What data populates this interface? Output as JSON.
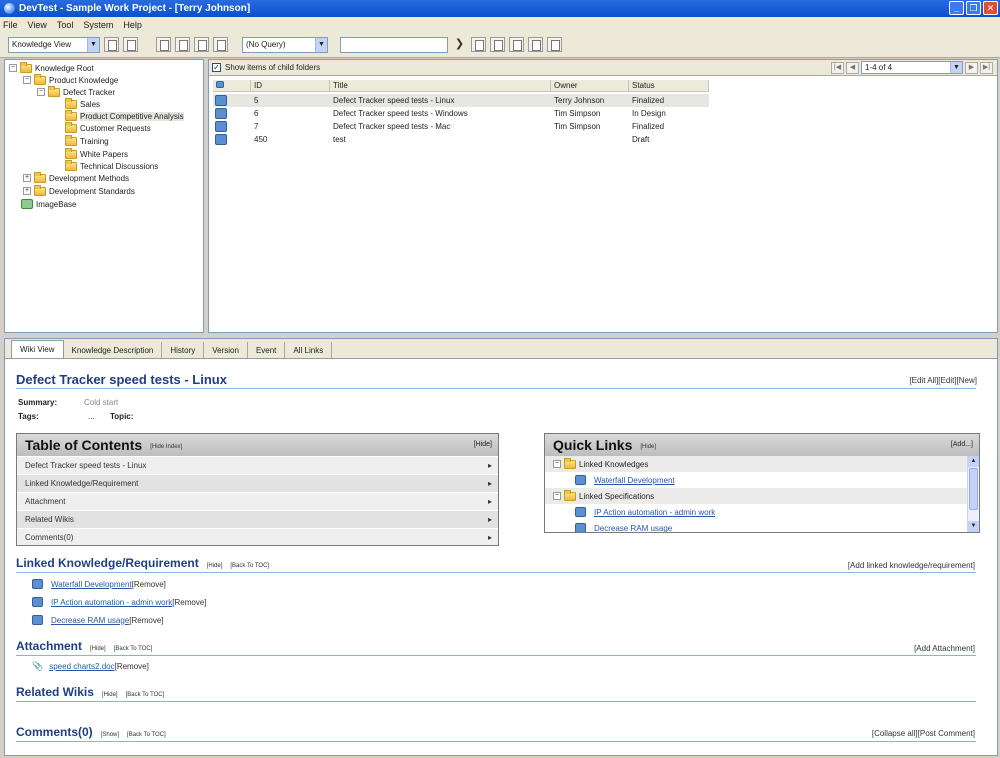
{
  "window": {
    "title": "DevTest - Sample Work Project - [Terry Johnson]"
  },
  "menu": [
    "File",
    "View",
    "Tool",
    "System",
    "Help"
  ],
  "toolbar": {
    "view_select": "Knowledge View",
    "query_select": "(No Query)",
    "search_value": ""
  },
  "tree": {
    "items": [
      {
        "label": "Knowledge Root",
        "level": 0,
        "expander": "-"
      },
      {
        "label": "Product Knowledge",
        "level": 1,
        "expander": "-"
      },
      {
        "label": "Defect Tracker",
        "level": 2,
        "expander": "-"
      },
      {
        "label": "Sales",
        "level": 3,
        "expander": ""
      },
      {
        "label": "Product Competitive Analysis",
        "level": 3,
        "expander": "",
        "selected": true
      },
      {
        "label": "Customer Requests",
        "level": 3,
        "expander": ""
      },
      {
        "label": "Training",
        "level": 3,
        "expander": ""
      },
      {
        "label": "White Papers",
        "level": 3,
        "expander": ""
      },
      {
        "label": "Technical Discussions",
        "level": 3,
        "expander": ""
      },
      {
        "label": "Development Methods",
        "level": 1,
        "expander": "+"
      },
      {
        "label": "Development Standards",
        "level": 1,
        "expander": "+"
      },
      {
        "label": "ImageBase",
        "level": 0,
        "expander": "",
        "image": true
      }
    ]
  },
  "list": {
    "show_child_label": "Show items of child folders",
    "pager": "1-4 of 4",
    "columns": [
      "ID",
      "Title",
      "Owner",
      "Status"
    ],
    "rows": [
      {
        "id": "5",
        "title": "Defect Tracker speed tests - Linux",
        "owner": "Terry Johnson",
        "status": "Finalized"
      },
      {
        "id": "6",
        "title": "Defect Tracker speed tests - Windows",
        "owner": "Tim Simpson",
        "status": "In Design"
      },
      {
        "id": "7",
        "title": "Defect Tracker speed tests - Mac",
        "owner": "Tim Simpson",
        "status": "Finalized"
      },
      {
        "id": "450",
        "title": "test",
        "owner": "",
        "status": "Draft"
      }
    ]
  },
  "tabs": [
    "Wiki View",
    "Knowledge Description",
    "History",
    "Version",
    "Event",
    "All Links"
  ],
  "wiki": {
    "title": "Defect Tracker speed tests - Linux",
    "top_links": "[Edit All][Edit][New]",
    "summary_label": "Summary:",
    "summary_value": "Cold start",
    "tags_label": "Tags:",
    "tags_value": "...",
    "topic_label": "Topic:",
    "toc": {
      "title": "Table of Contents",
      "hide_index": "[Hide Index]",
      "hide": "[Hide]",
      "items": [
        "Defect Tracker speed tests - Linux",
        "Linked Knowledge/Requirement",
        "Attachment",
        "Related Wikis",
        "Comments(0)"
      ]
    },
    "quick_links": {
      "title": "Quick Links",
      "hide": "[Hide]",
      "add": "[Add...]",
      "group1": "Linked Knowledges",
      "group1_items": [
        "Waterfall Development"
      ],
      "group2": "Linked Specifications",
      "group2_items": [
        "IP Action automation - admin work",
        "Decrease RAM usage"
      ]
    },
    "linked": {
      "title": "Linked Knowledge/Requirement",
      "hide": "[Hide]",
      "back": "[Back To TOC]",
      "add": "[Add linked knowledge/requirement]",
      "items": [
        {
          "label": "Waterfall Development",
          "remove": "[Remove]"
        },
        {
          "label": "IP Action automation - admin work",
          "remove": "[Remove]"
        },
        {
          "label": "Decrease RAM usage",
          "remove": "[Remove]"
        }
      ]
    },
    "attachment": {
      "title": "Attachment",
      "hide": "[Hide]",
      "back": "[Back To TOC]",
      "add": "[Add Attachment]",
      "file": "speed charts2.doc",
      "remove": "[Remove]"
    },
    "related": {
      "title": "Related Wikis",
      "hide": "[Hide]",
      "back": "[Back To TOC]"
    },
    "comments": {
      "title": "Comments(0)",
      "show": "[Show]",
      "back": "[Back To TOC]",
      "actions": "[Collapse all][Post Comment]"
    }
  }
}
